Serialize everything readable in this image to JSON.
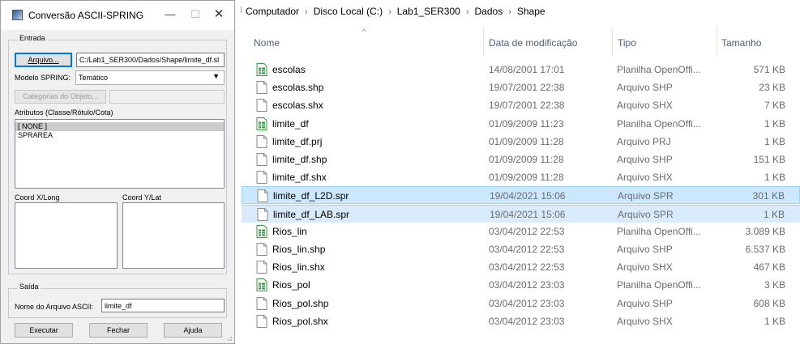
{
  "dialog": {
    "title": "Conversão ASCII-SPRING",
    "controls": {
      "minimize": "—",
      "maximize": "☐",
      "close": "✕"
    },
    "entrada": {
      "label": "Entrada",
      "arquivo_button": "Arquivo...",
      "arquivo_path": "C:/Lab1_SER300/Dados/Shape/limite_df.sl",
      "modelo_label": "Modelo SPRING:",
      "modelo_value": "Temático",
      "categorias_button": "Categorias do Objeto...",
      "atributos_label": "Atributos (Classe/Rótulo/Cota)",
      "atributos_items": [
        "[ NONE ]",
        "SPRAREA"
      ],
      "coord_x_label": "Coord X/Long",
      "coord_y_label": "Coord Y/Lat"
    },
    "saida": {
      "label": "Saída",
      "nome_label": "Nome do Arquivo ASCII:",
      "nome_value": "limite_df"
    },
    "buttons": {
      "executar": "Executar",
      "fechar": "Fechar",
      "ajuda": "Ajuda"
    }
  },
  "explorer": {
    "breadcrumb": [
      "Computador",
      "Disco Local (C:)",
      "Lab1_SER300",
      "Dados",
      "Shape"
    ],
    "columns": {
      "name": "Nome",
      "date": "Data de modificação",
      "type": "Tipo",
      "size": "Tamanho"
    },
    "files": [
      {
        "name": "escolas",
        "date": "14/08/2001 17:01",
        "type": "Planilha OpenOffi...",
        "size": "571 KB",
        "icon": "spreadsheet-icon"
      },
      {
        "name": "escolas.shp",
        "date": "19/07/2001 22:38",
        "type": "Arquivo SHP",
        "size": "23 KB",
        "icon": "file-icon"
      },
      {
        "name": "escolas.shx",
        "date": "19/07/2001 22:38",
        "type": "Arquivo SHX",
        "size": "7 KB",
        "icon": "file-icon"
      },
      {
        "name": "limite_df",
        "date": "01/09/2009 11:23",
        "type": "Planilha OpenOffi...",
        "size": "1 KB",
        "icon": "spreadsheet-icon"
      },
      {
        "name": "limite_df.prj",
        "date": "01/09/2009 11:28",
        "type": "Arquivo PRJ",
        "size": "1 KB",
        "icon": "file-icon"
      },
      {
        "name": "limite_df.shp",
        "date": "01/09/2009 11:28",
        "type": "Arquivo SHP",
        "size": "151 KB",
        "icon": "file-icon"
      },
      {
        "name": "limite_df.shx",
        "date": "01/09/2009 11:28",
        "type": "Arquivo SHX",
        "size": "1 KB",
        "icon": "file-icon"
      },
      {
        "name": "limite_df_L2D.spr",
        "date": "19/04/2021 15:06",
        "type": "Arquivo SPR",
        "size": "301 KB",
        "icon": "file-icon",
        "selected": true
      },
      {
        "name": "limite_df_LAB.spr",
        "date": "19/04/2021 15:06",
        "type": "Arquivo SPR",
        "size": "1 KB",
        "icon": "file-icon",
        "selected": true
      },
      {
        "name": "Rios_lin",
        "date": "03/04/2012 22:53",
        "type": "Planilha OpenOffi...",
        "size": "3.089 KB",
        "icon": "spreadsheet-icon"
      },
      {
        "name": "Rios_lin.shp",
        "date": "03/04/2012 22:53",
        "type": "Arquivo SHP",
        "size": "6.537 KB",
        "icon": "file-icon"
      },
      {
        "name": "Rios_lin.shx",
        "date": "03/04/2012 22:53",
        "type": "Arquivo SHX",
        "size": "467 KB",
        "icon": "file-icon"
      },
      {
        "name": "Rios_pol",
        "date": "03/04/2012 23:03",
        "type": "Planilha OpenOffi...",
        "size": "3 KB",
        "icon": "spreadsheet-icon"
      },
      {
        "name": "Rios_pol.shp",
        "date": "03/04/2012 23:03",
        "type": "Arquivo SHP",
        "size": "608 KB",
        "icon": "file-icon"
      },
      {
        "name": "Rios_pol.shx",
        "date": "03/04/2012 23:03",
        "type": "Arquivo SHX",
        "size": "1 KB",
        "icon": "file-icon"
      }
    ]
  },
  "colors": {
    "selection": "#cce8ff",
    "selection_border": "#99d1ff",
    "spreadsheet_icon": "#2e9e3d"
  }
}
